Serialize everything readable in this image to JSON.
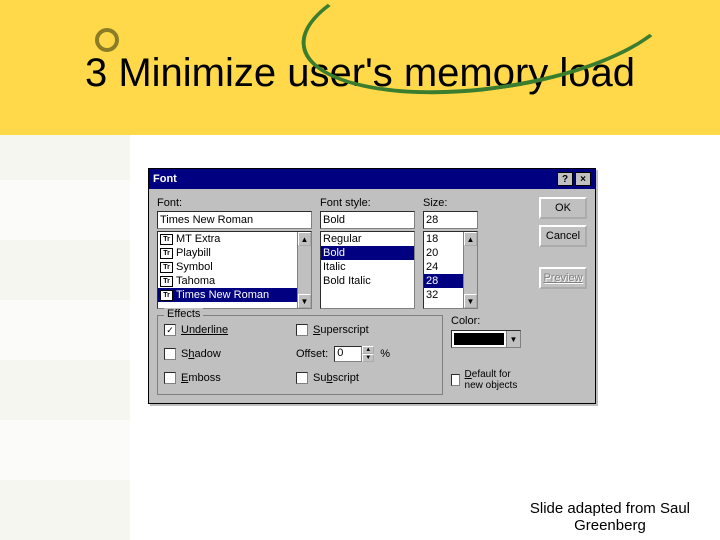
{
  "slide": {
    "title": "3 Minimize user's memory load",
    "credit_l1": "Slide adapted from Saul",
    "credit_l2": "Greenberg"
  },
  "dialog": {
    "title": "Font",
    "help": "?",
    "close": "×",
    "font": {
      "label": "Font:",
      "value": "Times New Roman",
      "options": [
        "MT Extra",
        "Playbill",
        "Symbol",
        "Tahoma",
        "Times New Roman"
      ]
    },
    "style": {
      "label": "Font style:",
      "value": "Bold",
      "options": [
        "Regular",
        "Bold",
        "Italic",
        "Bold Italic"
      ]
    },
    "size": {
      "label": "Size:",
      "value": "28",
      "options": [
        "18",
        "20",
        "24",
        "28",
        "32"
      ]
    },
    "buttons": {
      "ok": "OK",
      "cancel": "Cancel",
      "preview": "Preview"
    },
    "effects": {
      "legend": "Effects",
      "underline": "Underline",
      "shadow": "Shadow",
      "emboss": "Emboss",
      "superscript": "Superscript",
      "subscript": "Subscript",
      "offset_label": "Offset:",
      "offset_value": "0",
      "offset_unit": "%"
    },
    "color": {
      "label": "Color:",
      "value": "#000000",
      "default_label": "Default for new objects"
    }
  }
}
